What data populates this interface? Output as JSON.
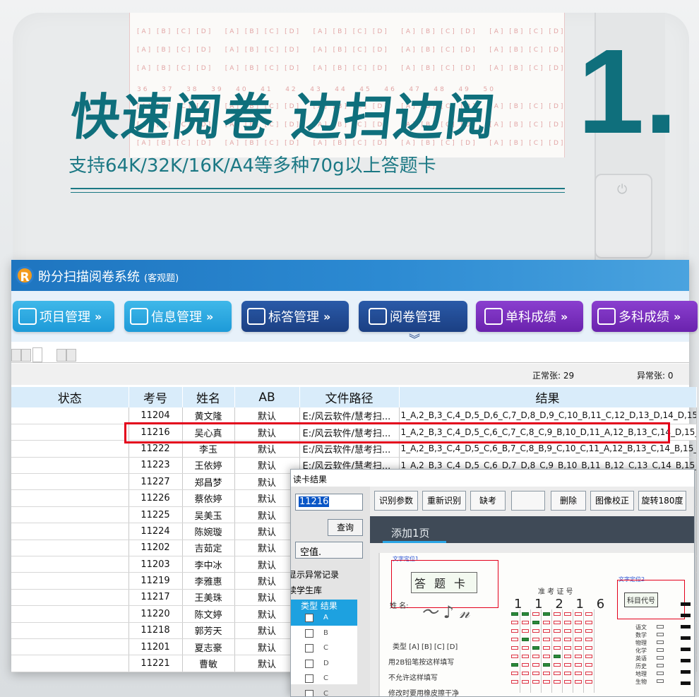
{
  "promo": {
    "headline": "快速阅卷 边扫边阅",
    "subhead": "支持64K/32K/16K/A4等多种70g以上答题卡",
    "number": "1."
  },
  "app": {
    "title": "盼分扫描阅卷系统",
    "subtitle": "(客观题)",
    "nav": [
      {
        "label": "项目管理",
        "icon": "home-icon"
      },
      {
        "label": "信息管理",
        "icon": "info-card-icon"
      },
      {
        "label": "标答管理",
        "icon": "house-edit-icon"
      },
      {
        "label": "阅卷管理",
        "icon": "monitor-icon"
      },
      {
        "label": "单科成绩",
        "icon": "wallet-icon"
      },
      {
        "label": "多科成绩",
        "icon": "chart-icon"
      }
    ],
    "nav_arrow": "»",
    "counts": {
      "normal": "正常张: 29",
      "abnormal": "异常张: 0"
    },
    "columns": [
      "状态",
      "考号",
      "姓名",
      "AB",
      "文件路径",
      "结果"
    ],
    "rows": [
      {
        "status": "",
        "id": "11204",
        "name": "黄文隆",
        "ab": "默认",
        "path": "E:/风云软件/慧考扫...",
        "result": "1_A,2_B,3_C,4_D,5_D,6_C,7_D,8_D,9_C,10_B,11_C,12_D,13_D,14_D,15_C"
      },
      {
        "status": "",
        "id": "11216",
        "name": "吴心真",
        "ab": "默认",
        "path": "E:/风云软件/慧考扫...",
        "result": "1_A,2_B,3_C,4_D,5_C,6_C,7_C,8_C,9_B,10_D,11_A,12_B,13_C,14_D,15_C"
      },
      {
        "status": "",
        "id": "11222",
        "name": "李玉",
        "ab": "默认",
        "path": "E:/风云软件/慧考扫...",
        "result": "1_A,2_B,3_C,4_D,5_C,6_B,7_C,8_B,9_C,10_C,11_A,12_B,13_C,14_B,15_C"
      },
      {
        "status": "",
        "id": "11223",
        "name": "王依婷",
        "ab": "默认",
        "path": "E:/风云软件/慧考扫...",
        "result": "1_A,2_B,3_C,4_D,5_C,6_D,7_D,8_C,9_B,10_B,11_B,12_C,13_C,14_B,15_C"
      },
      {
        "status": "",
        "id": "11227",
        "name": "郑昌梦",
        "ab": "默认",
        "path": "",
        "result": ""
      },
      {
        "status": "",
        "id": "11226",
        "name": "蔡依婷",
        "ab": "默认",
        "path": "",
        "result": ""
      },
      {
        "status": "",
        "id": "11225",
        "name": "吴美玉",
        "ab": "默认",
        "path": "",
        "result": ""
      },
      {
        "status": "",
        "id": "11224",
        "name": "陈婉璇",
        "ab": "默认",
        "path": "",
        "result": ""
      },
      {
        "status": "",
        "id": "11202",
        "name": "吉茹定",
        "ab": "默认",
        "path": "",
        "result": ""
      },
      {
        "status": "",
        "id": "11203",
        "name": "李中冰",
        "ab": "默认",
        "path": "",
        "result": ""
      },
      {
        "status": "",
        "id": "11219",
        "name": "李雅惠",
        "ab": "默认",
        "path": "",
        "result": ""
      },
      {
        "status": "",
        "id": "11217",
        "name": "王美珠",
        "ab": "默认",
        "path": "",
        "result": ""
      },
      {
        "status": "",
        "id": "11220",
        "name": "陈文婷",
        "ab": "默认",
        "path": "",
        "result": ""
      },
      {
        "status": "",
        "id": "11218",
        "name": "郭芳天",
        "ab": "默认",
        "path": "",
        "result": ""
      },
      {
        "status": "",
        "id": "11201",
        "name": "夏志豪",
        "ab": "默认",
        "path": "",
        "result": ""
      },
      {
        "status": "",
        "id": "11221",
        "name": "曹敏",
        "ab": "默认",
        "path": "",
        "result": ""
      }
    ]
  },
  "dialog": {
    "title": "读卡结果",
    "id_value": "11216",
    "query_label": "查询",
    "null_value": "空值.",
    "show_abnormal": "显示异常记录",
    "student_db": "读学生库",
    "type_head": "类型  结果",
    "type_rows": [
      "A",
      "B",
      "C",
      "D",
      "C",
      "C"
    ],
    "tools": [
      "识别参数",
      "重新识别",
      "缺考",
      "",
      "删除",
      "图像校正",
      "旋转180度"
    ],
    "page_tab": "添加1页",
    "sheet": {
      "anchor1": "文字定位1",
      "anchor2": "文字定位2",
      "card_title": "答题卡",
      "name_label": "姓 名:",
      "zkzh": "准  考  证  号",
      "digits": "1 1 2 1 6",
      "type_label": "类型  [A] [B] [C] [D]",
      "note1": "用2B铅笔按这样填写",
      "note2": "不允许这样填写",
      "note3": "修改时要用橡皮擦干净",
      "subject_code": "科目代号",
      "subjects": [
        "语文",
        "数学",
        "物理",
        "化学",
        "英语",
        "历史",
        "地理",
        "生物"
      ]
    }
  },
  "colors": {
    "accent": "#0f6f7c",
    "highlight": "#e3001b",
    "header_blue": "#d9ecfa"
  }
}
